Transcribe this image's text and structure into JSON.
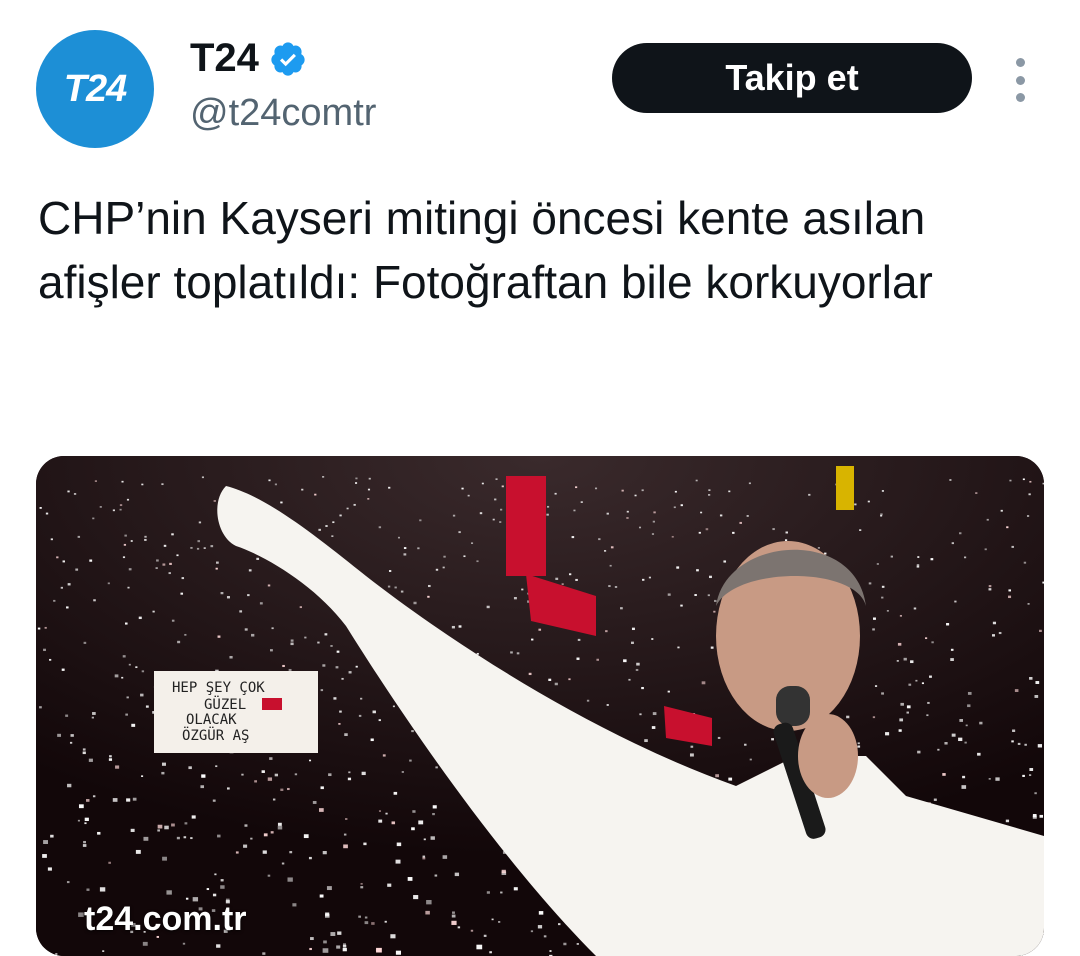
{
  "account": {
    "avatar_text": "T24",
    "name": "T24",
    "handle": "@t24comtr",
    "verified": true
  },
  "actions": {
    "follow_label": "Takip et"
  },
  "tweet": {
    "text": "CHP’nin Kayseri mitingi öncesi kente asılan afişler toplatıldı: Fotoğraftan bile korkuyorlar"
  },
  "media": {
    "domain_label": "t24.com.tr",
    "sign_lines": [
      "HEP ŞEY ÇOK",
      "GÜZEL",
      "OLACAK",
      "ÖZGÜR AŞ"
    ]
  },
  "colors": {
    "avatar": "#1d8fd6",
    "verified": "#1d9bf0",
    "button": "#0f1419",
    "handle": "#536471"
  },
  "icons": {
    "verified": "verified-badge-icon",
    "more": "more-options-icon"
  }
}
